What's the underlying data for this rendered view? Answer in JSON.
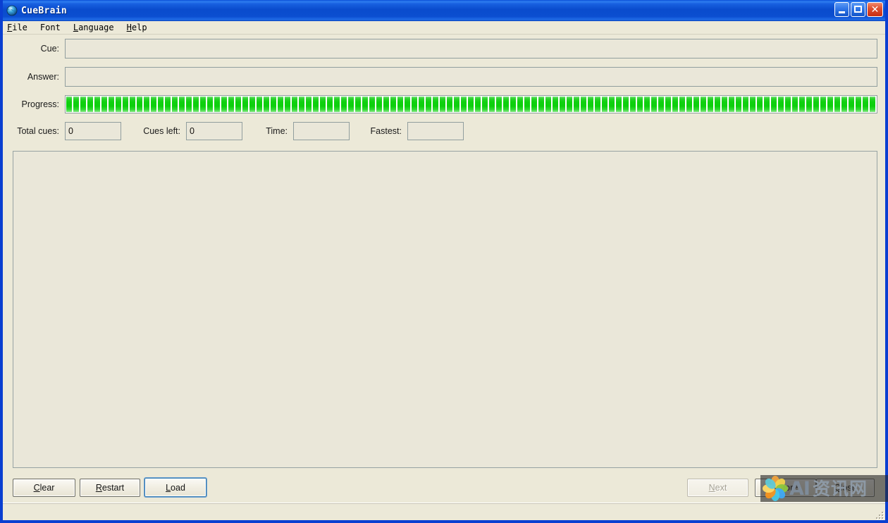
{
  "window": {
    "title": "CueBrain",
    "icon": "globe-icon",
    "controls": {
      "minimize": "Minimize",
      "maximize": "Maximize",
      "close": "Close"
    }
  },
  "menubar": {
    "items": [
      {
        "label": "File",
        "mnemonic": "F"
      },
      {
        "label": "Font",
        "mnemonic": ""
      },
      {
        "label": "Language",
        "mnemonic": "L"
      },
      {
        "label": "Help",
        "mnemonic": "H"
      }
    ]
  },
  "form": {
    "cue": {
      "label": "Cue:",
      "value": "",
      "placeholder": ""
    },
    "answer": {
      "label": "Answer:",
      "value": "",
      "placeholder": ""
    },
    "progress": {
      "label": "Progress:",
      "percent": 100,
      "segments": 125
    },
    "total_cues": {
      "label": "Total cues:",
      "value": "0"
    },
    "cues_left": {
      "label": "Cues left:",
      "value": "0"
    },
    "time": {
      "label": "Time:",
      "value": ""
    },
    "fastest": {
      "label": "Fastest:",
      "value": ""
    }
  },
  "content": {
    "text": ""
  },
  "buttons": {
    "clear": {
      "label": "Clear",
      "mnemonic": "C",
      "state": "enabled"
    },
    "restart": {
      "label": "Restart",
      "mnemonic": "R",
      "state": "enabled"
    },
    "load": {
      "label": "Load",
      "mnemonic": "L",
      "state": "focused"
    },
    "next": {
      "label": "Next",
      "mnemonic": "N",
      "state": "disabled"
    },
    "ignore": {
      "label": "Ignore",
      "mnemonic": "I",
      "state": "enabled"
    },
    "close": {
      "label": "Close",
      "mnemonic": "C",
      "state": "enabled"
    }
  },
  "statusbar": {
    "text": ""
  },
  "watermark": {
    "ai_text": "AI",
    "cn_text": "资讯网",
    "logo": "flower-logo",
    "petal_colors": [
      "#f0a23c",
      "#f2d24b",
      "#8cc63f",
      "#3fa9f5",
      "#46c8e8",
      "#f7941e",
      "#ffd966",
      "#5ec9d8"
    ]
  },
  "colors": {
    "title_bar": "#0a4ccd",
    "window_frame": "#0a3fd1",
    "client_bg": "#ece9d8",
    "field_bg": "#eae7d9",
    "field_border": "#919e9e",
    "progress_green": "#0fd10f",
    "close_button": "#c62d13"
  }
}
